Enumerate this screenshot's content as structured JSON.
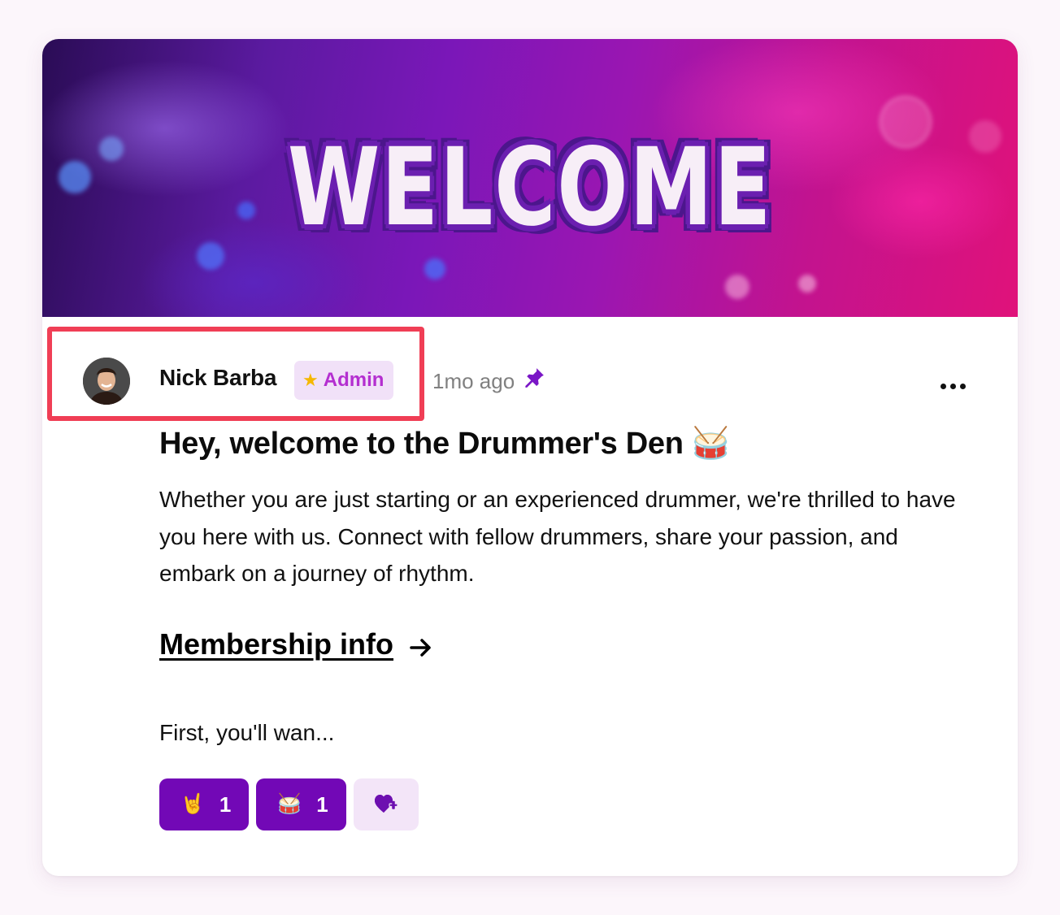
{
  "banner": {
    "text": "WELCOME"
  },
  "post": {
    "author": {
      "name": "Nick Barba",
      "badge_label": "Admin",
      "badge_icon": "star-icon"
    },
    "time_ago": "1mo ago",
    "pinned_icon": "pin-icon",
    "menu_icon": "more-horizontal-icon",
    "title": "Hey, welcome to the Drummer's Den 🥁",
    "body": "Whether you are just starting or an experienced drummer, we're thrilled to have you here with us. Connect with fellow drummers, share your passion, and embark on a journey of rhythm.",
    "link_label": "Membership info",
    "link_arrow_icon": "arrow-right-icon",
    "excerpt": "First, you'll wan...",
    "reactions": [
      {
        "emoji": "🤘",
        "count": "1"
      },
      {
        "emoji": "🥁",
        "count": "1"
      }
    ],
    "add_reaction_icon": "heart-plus-icon"
  },
  "colors": {
    "accent": "#7208b6",
    "badge_text": "#b42fd0",
    "badge_bg": "#f1e1f8",
    "highlight": "#f03e55"
  }
}
